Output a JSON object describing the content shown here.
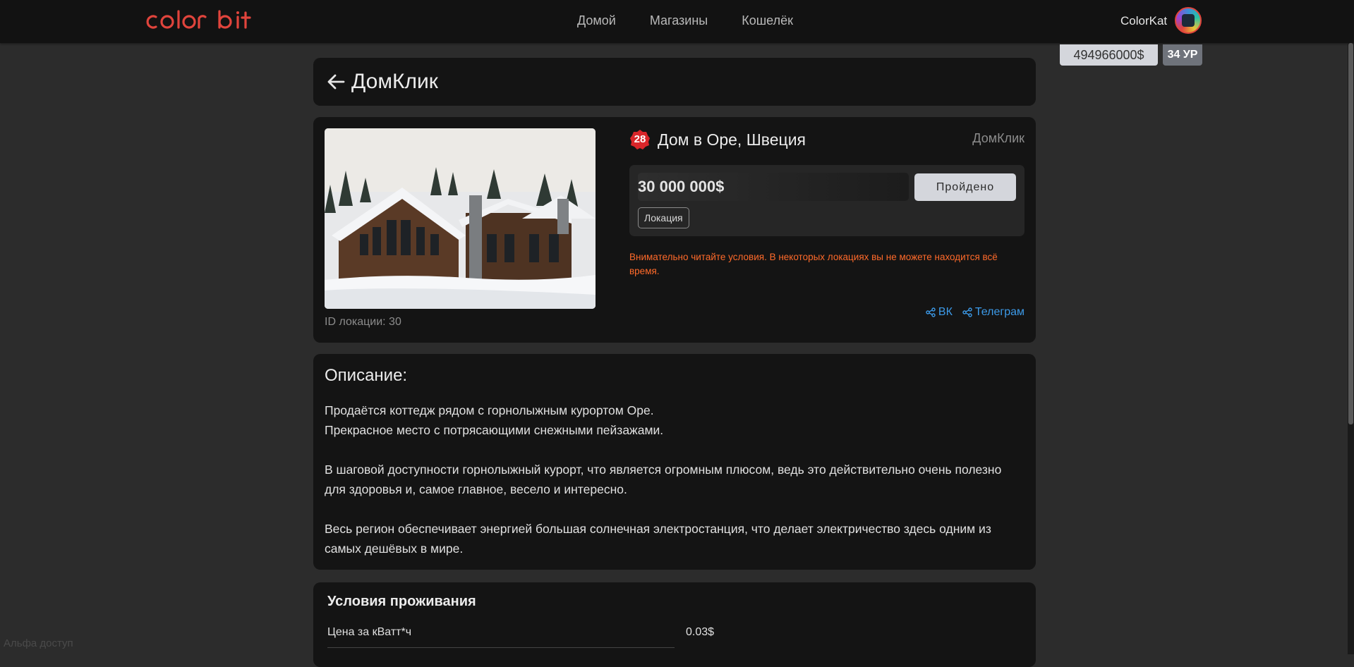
{
  "navbar": {
    "logo": "COLOR bIt",
    "links": [
      "Домой",
      "Магазины",
      "Кошелёк"
    ],
    "user_name": "ColorKat",
    "balance": "494966000$",
    "level": "34 УР"
  },
  "header": {
    "title": "ДомКлик"
  },
  "property": {
    "badge": "28",
    "title": "Дом в Оре, Швеция",
    "shop": "ДомКлик",
    "price": "30 000 000$",
    "status_button": "Пройдено",
    "tag": "Локация",
    "warning": "Внимательно читайте условия. В некоторых локациях вы не можете находится всё время.",
    "location_id": "ID локации: 30",
    "share": [
      "ВК",
      "Телеграм"
    ]
  },
  "description": {
    "title": "Описание:",
    "paragraphs": [
      "Продаётся коттедж рядом с горнолыжным курортом Оре.\nПрекрасное место с потрясающими снежными пейзажами.",
      "В шаговой доступности горнолыжный курорт, что является огромным плюсом, ведь это действительно очень полезно для здоровья и, самое главное, весело и интересно.",
      "Весь регион обеспечивает энергией большая солнечная электростанция, что делает электричество здесь одним из самых дешёвых в мире."
    ]
  },
  "conditions": {
    "title": "Условия проживания",
    "rows": [
      {
        "key": "Цена за кВатт*ч",
        "value": "0.03$"
      }
    ]
  },
  "footer": {
    "alpha": "Альфа доступ"
  },
  "colors": {
    "accent": "#e0443c",
    "warning": "#ff6a2a",
    "link": "#3c9ae8"
  },
  "icons": [
    "back-arrow-icon",
    "share-icon",
    "avatar"
  ]
}
